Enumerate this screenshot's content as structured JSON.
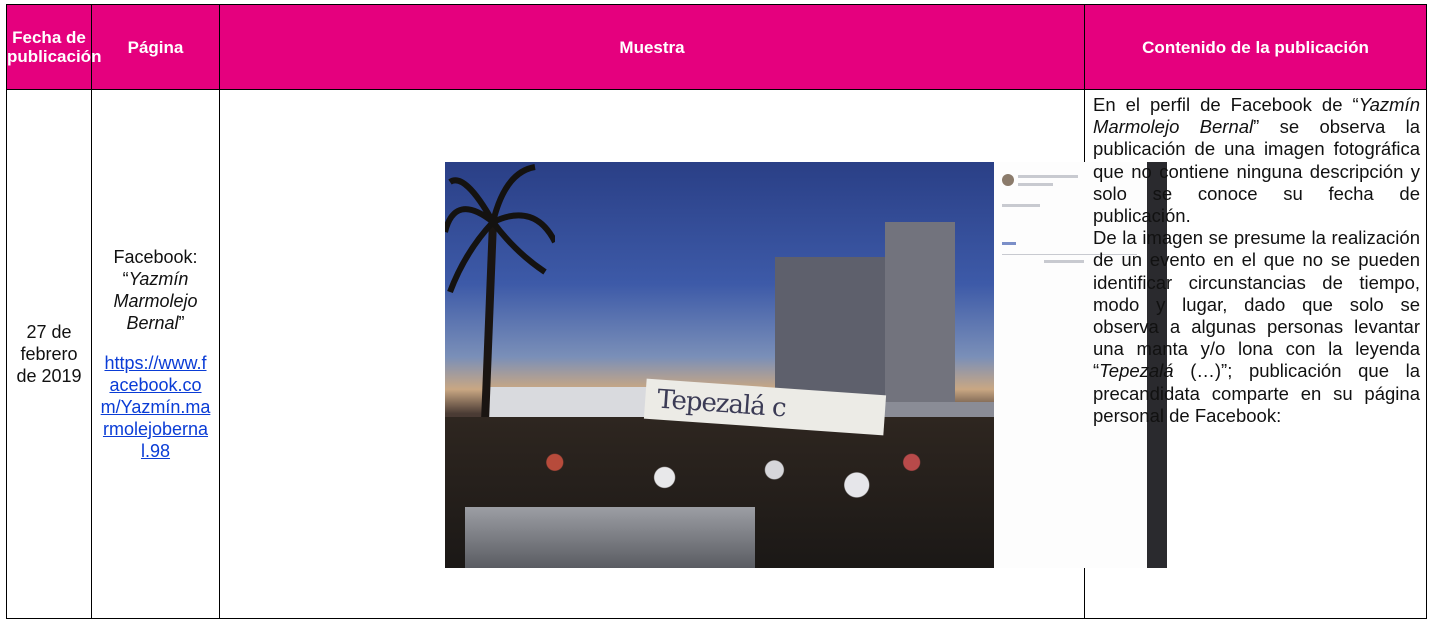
{
  "headers": {
    "fecha": "Fecha de publicación",
    "pagina": "Página",
    "muestra": "Muestra",
    "contenido": "Contenido de la publicación"
  },
  "row": {
    "fecha": "27 de febrero de 2019",
    "pagina_platform": "Facebook:",
    "pagina_open_quote": "“",
    "pagina_name": "Yazmín Marmolejo Bernal",
    "pagina_close_quote": "”",
    "pagina_url": "https://www.facebook.com/Yazmín.marmolejobernal.98",
    "muestra_banner_text": "Tepezalá c",
    "contenido": {
      "p1_a": "En el perfil de Facebook de “",
      "p1_name": "Yazmín Marmolejo Bernal",
      "p1_b": "” se observa la publicación de una imagen fotográfica que no contiene ninguna descripción y solo se conoce su fecha de publicación.",
      "p2_a": "De la imagen se presume la realización de un evento en el que no se pueden identificar circunstancias de tiempo, modo y lugar, dado que solo se observa a algunas personas levantar una manta y/o lona con la leyenda “",
      "p2_term": "Tepezalá",
      "p2_b": " (…)”; publicación que la precandidata comparte en su página personal de Facebook:"
    }
  },
  "colors": {
    "header_bg": "#e5007e",
    "header_text": "#ffffff",
    "link": "#0a3cd6"
  }
}
